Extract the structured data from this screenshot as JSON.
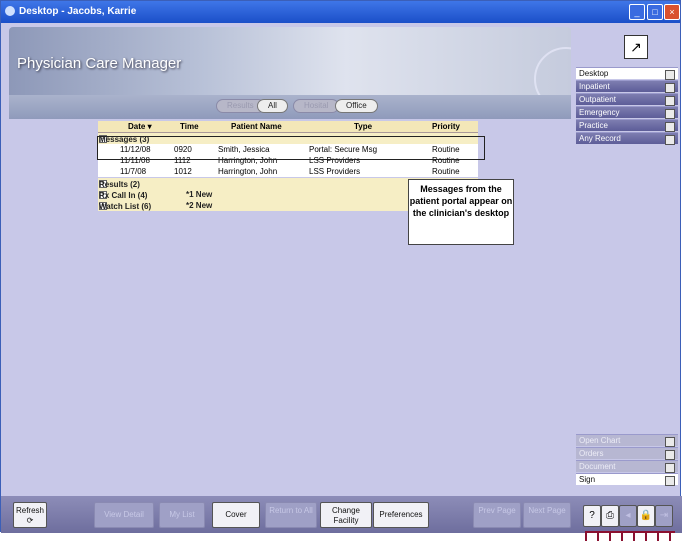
{
  "window": {
    "title": "Desktop - Jacobs, Karrie"
  },
  "banner": {
    "app_title": "Physician Care Manager"
  },
  "filters": [
    {
      "label": "Results",
      "active": false
    },
    {
      "label": "All",
      "active": true
    },
    {
      "label": "Hosital",
      "active": false
    },
    {
      "label": "Office",
      "active": true
    }
  ],
  "grid": {
    "columns": [
      "Date ▾",
      "Time",
      "Patient Name",
      "Type",
      "Priority"
    ],
    "sections": {
      "messages": "Messages (3)",
      "results": "Results (2)",
      "rx": "Rx Call In (4)",
      "rx_new": "*1 New",
      "watch": "Watch List (6)",
      "watch_new": "*2 New"
    },
    "rows": [
      {
        "date": "11/12/08",
        "time": "0920",
        "patient": "Smith, Jessica",
        "type": "Portal: Secure Msg",
        "priority": "Routine"
      },
      {
        "date": "11/11/08",
        "time": "1112",
        "patient": "Harrington, John",
        "type": "LSS Providers",
        "priority": "Routine"
      },
      {
        "date": "11/7/08",
        "time": "1012",
        "patient": "Harrington, John",
        "type": "LSS Providers",
        "priority": "Routine"
      }
    ]
  },
  "callout": {
    "text": "Messages from the patient portal appear on the clinician's desktop"
  },
  "nav": {
    "top": [
      {
        "label": "Desktop",
        "active": true
      },
      {
        "label": "Inpatient",
        "active": false
      },
      {
        "label": "Outpatient",
        "active": false
      },
      {
        "label": "Emergency",
        "active": false
      },
      {
        "label": "Practice",
        "active": false
      },
      {
        "label": "Any Record",
        "active": false
      }
    ],
    "bottom": [
      {
        "label": "Open Chart",
        "enabled": false
      },
      {
        "label": "Orders",
        "enabled": false
      },
      {
        "label": "Document",
        "enabled": false
      },
      {
        "label": "Sign",
        "enabled": true
      }
    ]
  },
  "toolbar": {
    "refresh": "Refresh",
    "view_detail": "View Detail",
    "my_list": "My List",
    "cover": "Cover",
    "return_to_all": "Return to All",
    "change_facility": "Change Facility",
    "preferences": "Preferences",
    "prev_page": "Prev Page",
    "next_page": "Next Page"
  },
  "icons": {
    "help": "?",
    "print": "print-icon",
    "back": "back-icon",
    "lock": "lock-icon",
    "exit": "exit-icon"
  }
}
